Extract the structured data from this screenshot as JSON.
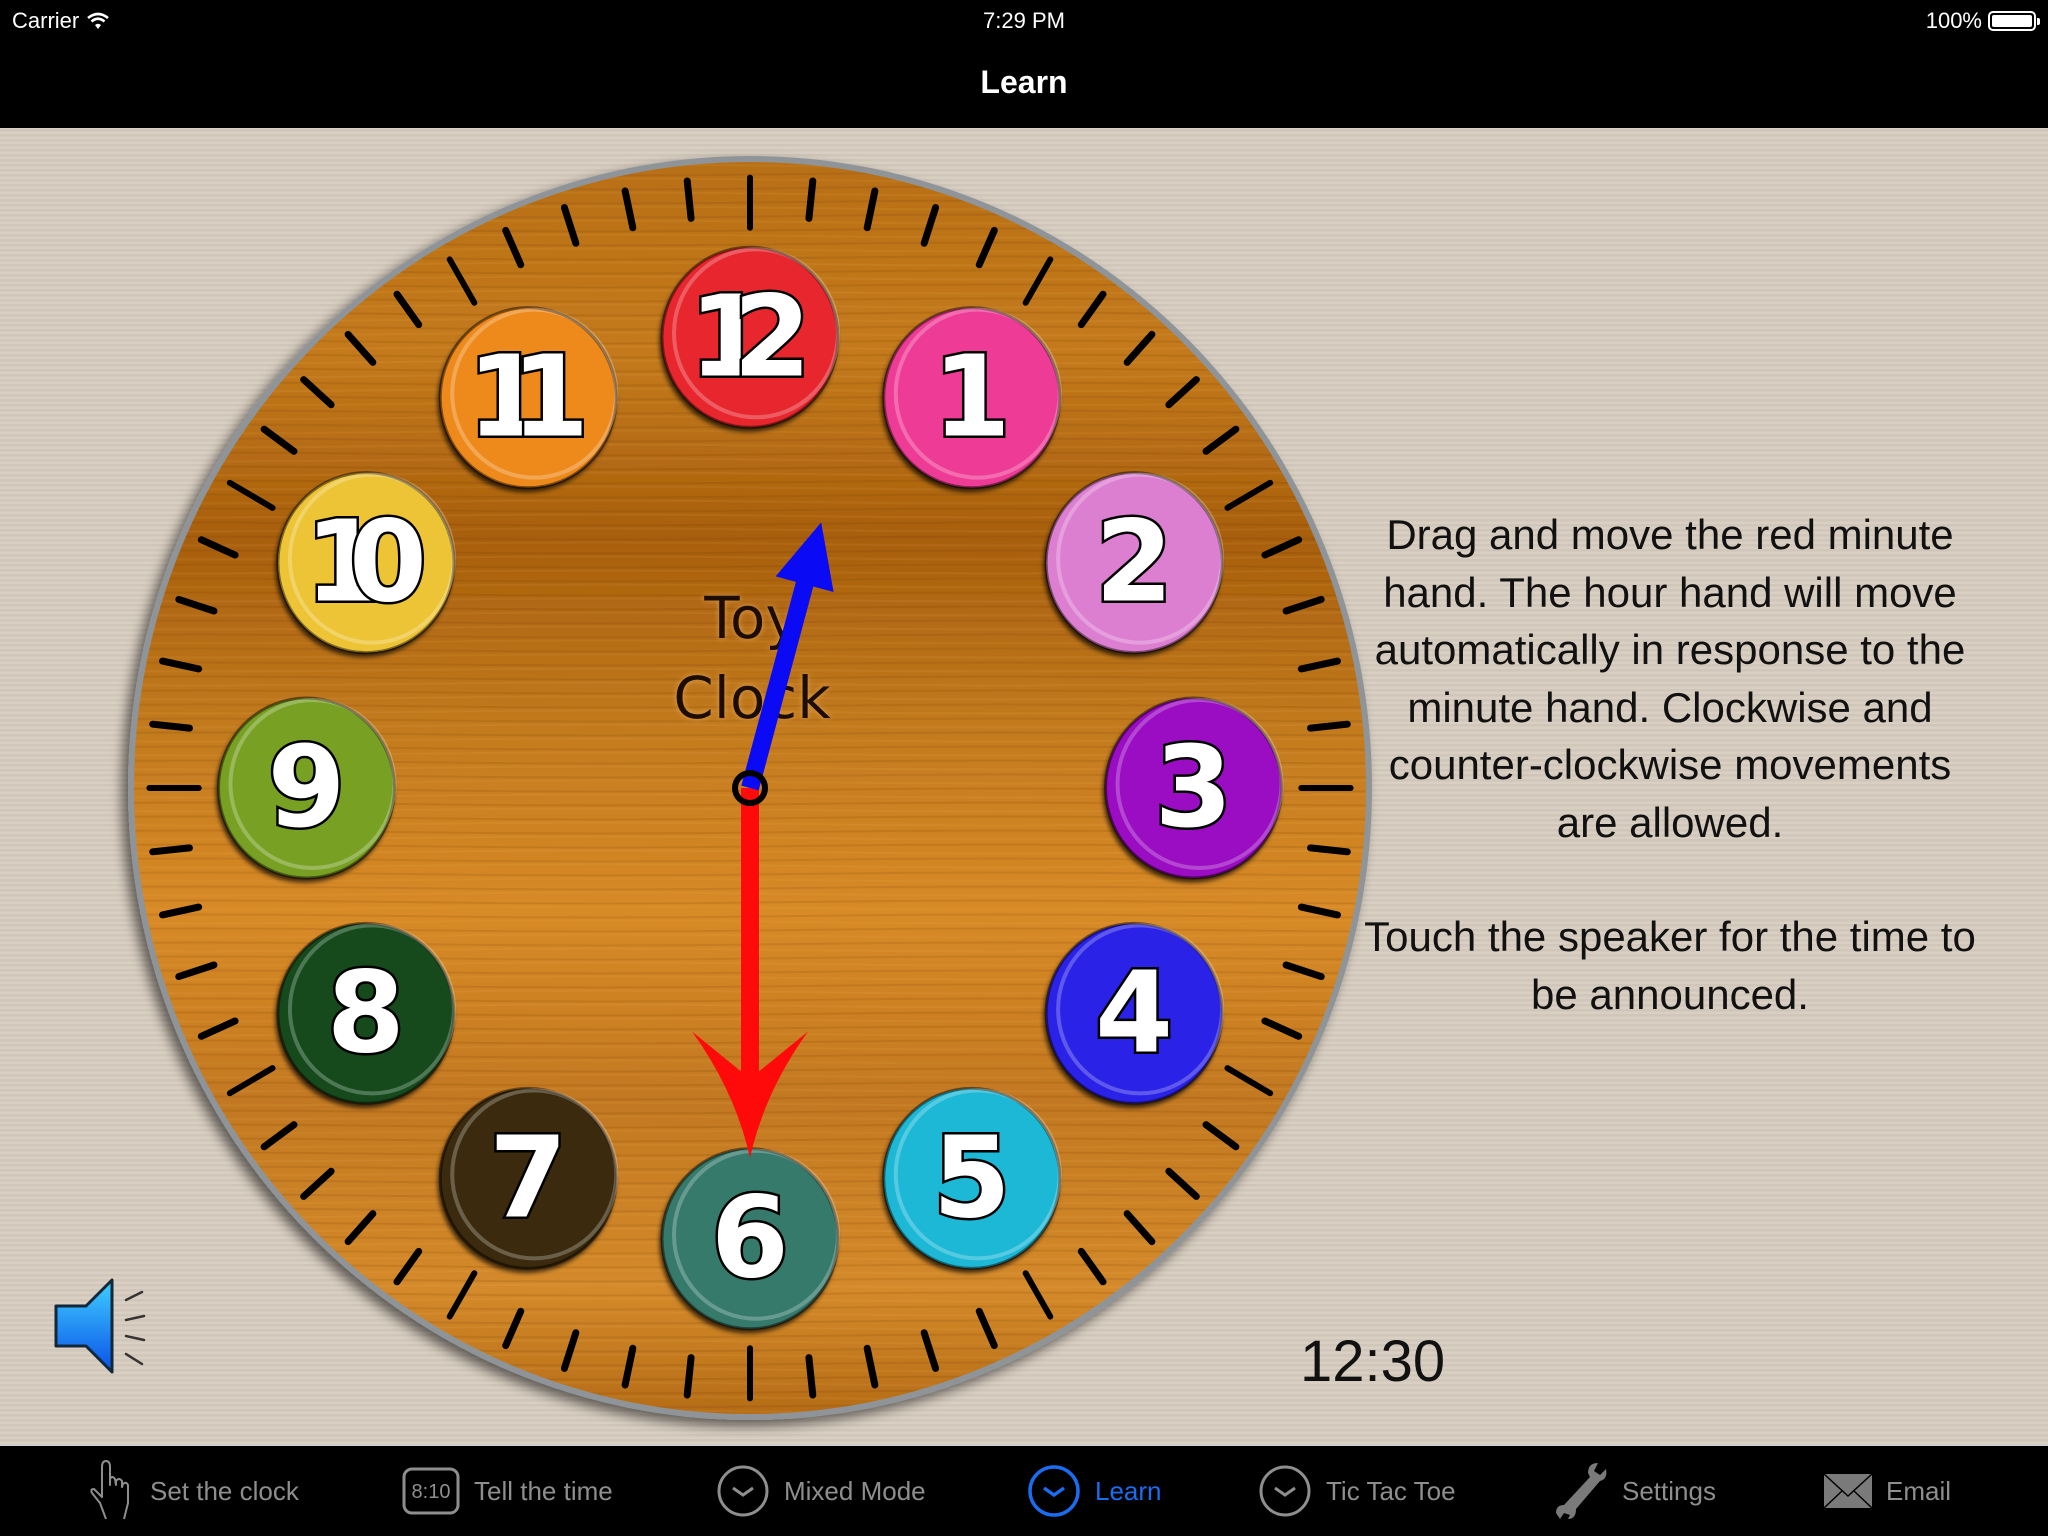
{
  "status_bar": {
    "carrier": "Carrier",
    "time": "7:29 PM",
    "battery": "100%"
  },
  "nav": {
    "title": "Learn"
  },
  "clock": {
    "label_line1": "Toy",
    "label_line2": "Clock",
    "hour": 12,
    "minute": 30,
    "numbers": [
      {
        "n": "12",
        "color": "#e8262f"
      },
      {
        "n": "1",
        "color": "#ee3b95"
      },
      {
        "n": "2",
        "color": "#dd7fd1"
      },
      {
        "n": "3",
        "color": "#9a0ac2"
      },
      {
        "n": "4",
        "color": "#2a20e6"
      },
      {
        "n": "5",
        "color": "#1fb8d6"
      },
      {
        "n": "6",
        "color": "#367a6a"
      },
      {
        "n": "7",
        "color": "#3a2a0c"
      },
      {
        "n": "8",
        "color": "#134a1c"
      },
      {
        "n": "9",
        "color": "#78a024"
      },
      {
        "n": "10",
        "color": "#ecc436"
      },
      {
        "n": "11",
        "color": "#ee8a1c"
      }
    ],
    "hour_hand_color": "#0a0af5",
    "minute_hand_color": "#ff0a0a"
  },
  "instructions": {
    "paragraph1": "Drag and move the red minute hand. The hour hand will move automatically in response to the minute hand. Clockwise and counter-clockwise movements are allowed.",
    "paragraph2": "Touch the speaker for the time to be announced."
  },
  "digital_time": "12:30",
  "tabs": [
    {
      "label": "Set the clock",
      "icon": "hand-pointer-icon",
      "active": false
    },
    {
      "label": "Tell the time",
      "icon": "digital-clock-icon",
      "icon_text": "8:10",
      "active": false
    },
    {
      "label": "Mixed Mode",
      "icon": "clock-icon",
      "active": false
    },
    {
      "label": "Learn",
      "icon": "clock-icon",
      "active": true
    },
    {
      "label": "Tic Tac Toe",
      "icon": "clock-icon",
      "active": false
    },
    {
      "label": "Settings",
      "icon": "wrench-icon",
      "active": false
    },
    {
      "label": "Email",
      "icon": "envelope-icon",
      "active": false
    }
  ],
  "colors": {
    "accent": "#1a6cf0",
    "tab_inactive": "#8e8e8e",
    "wood": "#c67a1e",
    "background": "#d7ccbf"
  }
}
